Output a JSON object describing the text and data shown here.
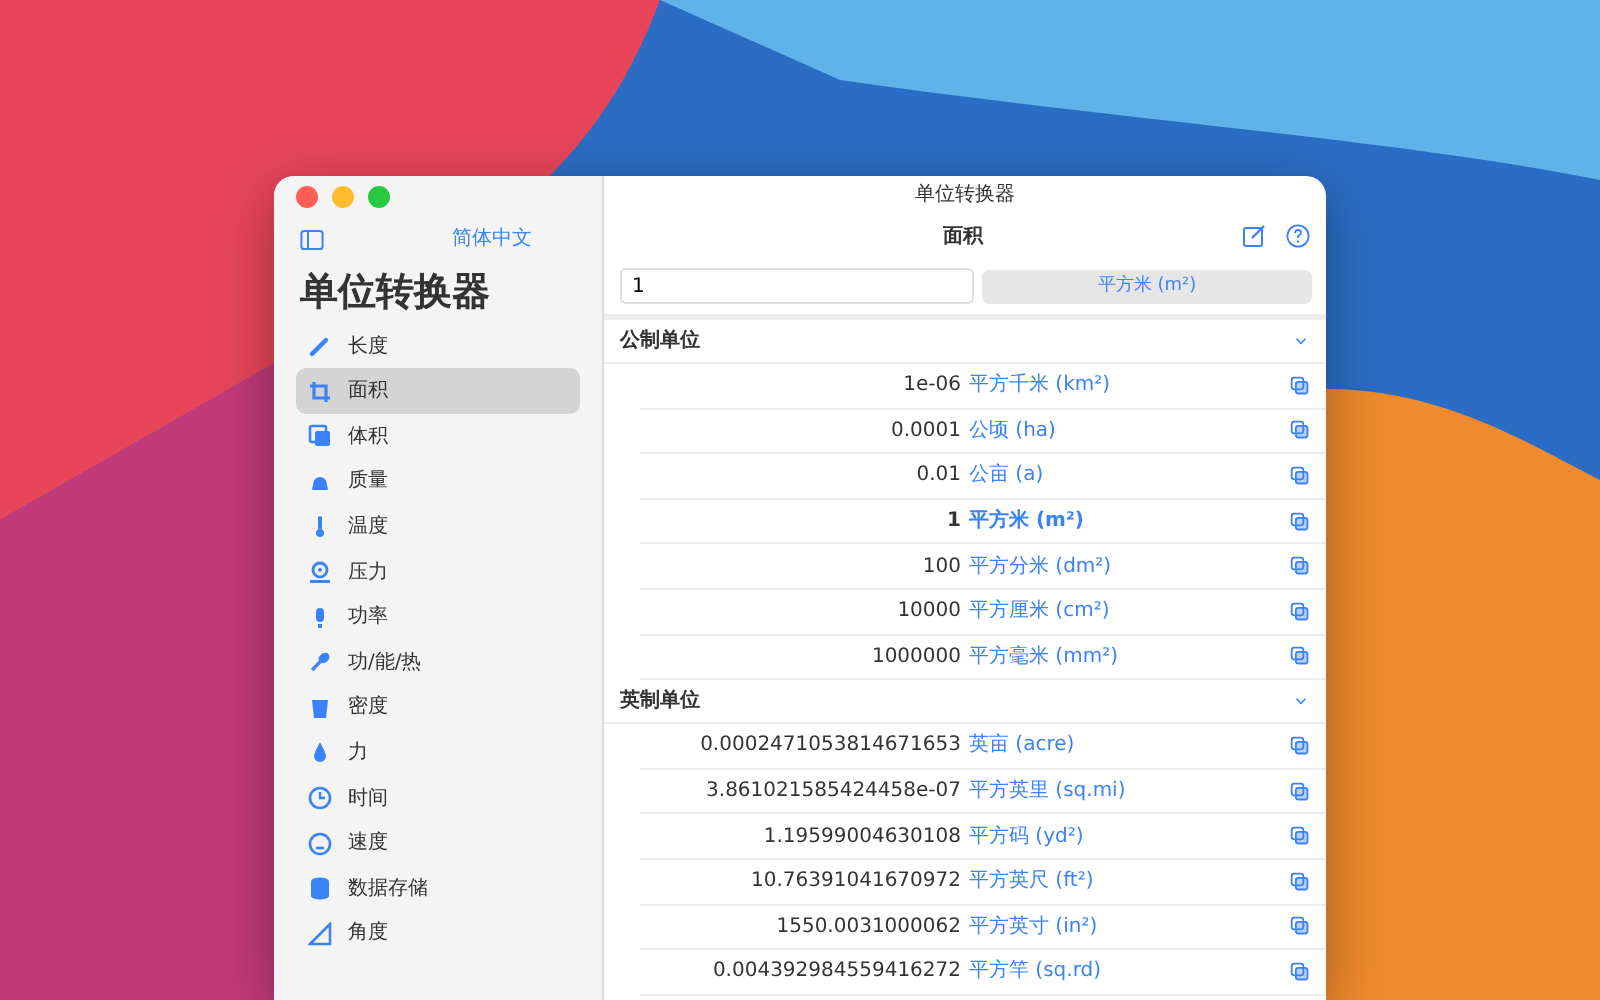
{
  "window": {
    "title": "单位转换器"
  },
  "sidebar": {
    "language_link": "简体中文",
    "heading": "单位转换器",
    "items": [
      {
        "label": "长度",
        "selected": false
      },
      {
        "label": "面积",
        "selected": true
      },
      {
        "label": "体积",
        "selected": false
      },
      {
        "label": "质量",
        "selected": false
      },
      {
        "label": "温度",
        "selected": false
      },
      {
        "label": "压力",
        "selected": false
      },
      {
        "label": "功率",
        "selected": false
      },
      {
        "label": "功/能/热",
        "selected": false
      },
      {
        "label": "密度",
        "selected": false
      },
      {
        "label": "力",
        "selected": false
      },
      {
        "label": "时间",
        "selected": false
      },
      {
        "label": "速度",
        "selected": false
      },
      {
        "label": "数据存储",
        "selected": false
      },
      {
        "label": "角度",
        "selected": false
      }
    ]
  },
  "toolbar": {
    "title": "面积"
  },
  "input": {
    "value": "1",
    "unit_button": "平方米 (m²)"
  },
  "sections": [
    {
      "title": "公制单位",
      "expanded": true,
      "rows": [
        {
          "value": "1e-06",
          "unit": "平方千米 (km²)",
          "selected": false
        },
        {
          "value": "0.0001",
          "unit": "公顷 (ha)",
          "selected": false
        },
        {
          "value": "0.01",
          "unit": "公亩 (a)",
          "selected": false
        },
        {
          "value": "1",
          "unit": "平方米 (m²)",
          "selected": true
        },
        {
          "value": "100",
          "unit": "平方分米 (dm²)",
          "selected": false
        },
        {
          "value": "10000",
          "unit": "平方厘米 (cm²)",
          "selected": false
        },
        {
          "value": "1000000",
          "unit": "平方毫米 (mm²)",
          "selected": false
        }
      ]
    },
    {
      "title": "英制单位",
      "expanded": true,
      "rows": [
        {
          "value": "0.0002471053814671653",
          "unit": "英亩 (acre)",
          "selected": false
        },
        {
          "value": "3.861021585424458e-07",
          "unit": "平方英里 (sq.mi)",
          "selected": false
        },
        {
          "value": "1.19599004630108",
          "unit": "平方码 (yd²)",
          "selected": false
        },
        {
          "value": "10.76391041670972",
          "unit": "平方英尺 (ft²)",
          "selected": false
        },
        {
          "value": "1550.0031000062",
          "unit": "平方英寸 (in²)",
          "selected": false
        },
        {
          "value": "0.004392984559416272",
          "unit": "平方竿 (sq.rd)",
          "selected": false
        }
      ]
    }
  ]
}
